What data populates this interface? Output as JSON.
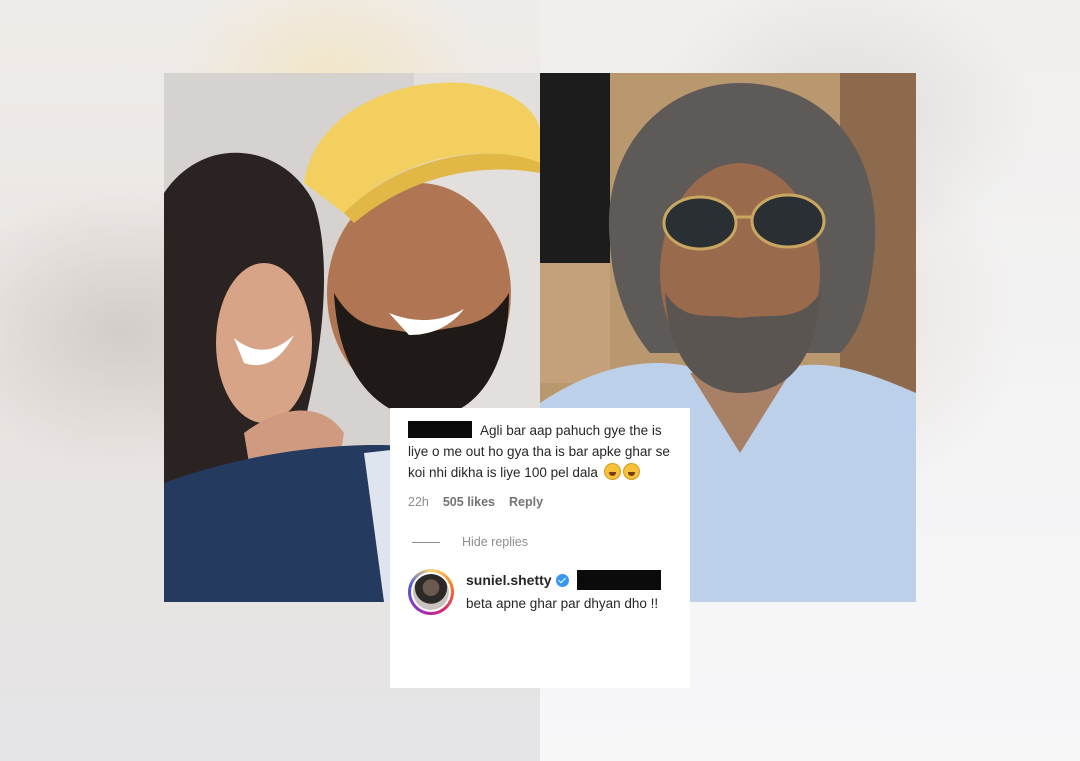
{
  "comment": {
    "text": "Agli bar aap pahuch gye the is liye o me out ho gya tha is bar apke ghar se koi nhi dikha is liye 100 pel dala",
    "emoji": "laughing-tears-emoji",
    "time": "22h",
    "likes": "505 likes",
    "reply_label": "Reply"
  },
  "replies_toggle": {
    "label": "Hide replies"
  },
  "reply": {
    "username": "suniel.shetty",
    "text": "beta apne ghar par dhyan dho !!",
    "verified_icon": "verified-badge-icon"
  },
  "colors": {
    "redaction": "#0a0a0a",
    "text": "#262626",
    "muted": "#8e8e8e",
    "verified": "#3897f0"
  }
}
